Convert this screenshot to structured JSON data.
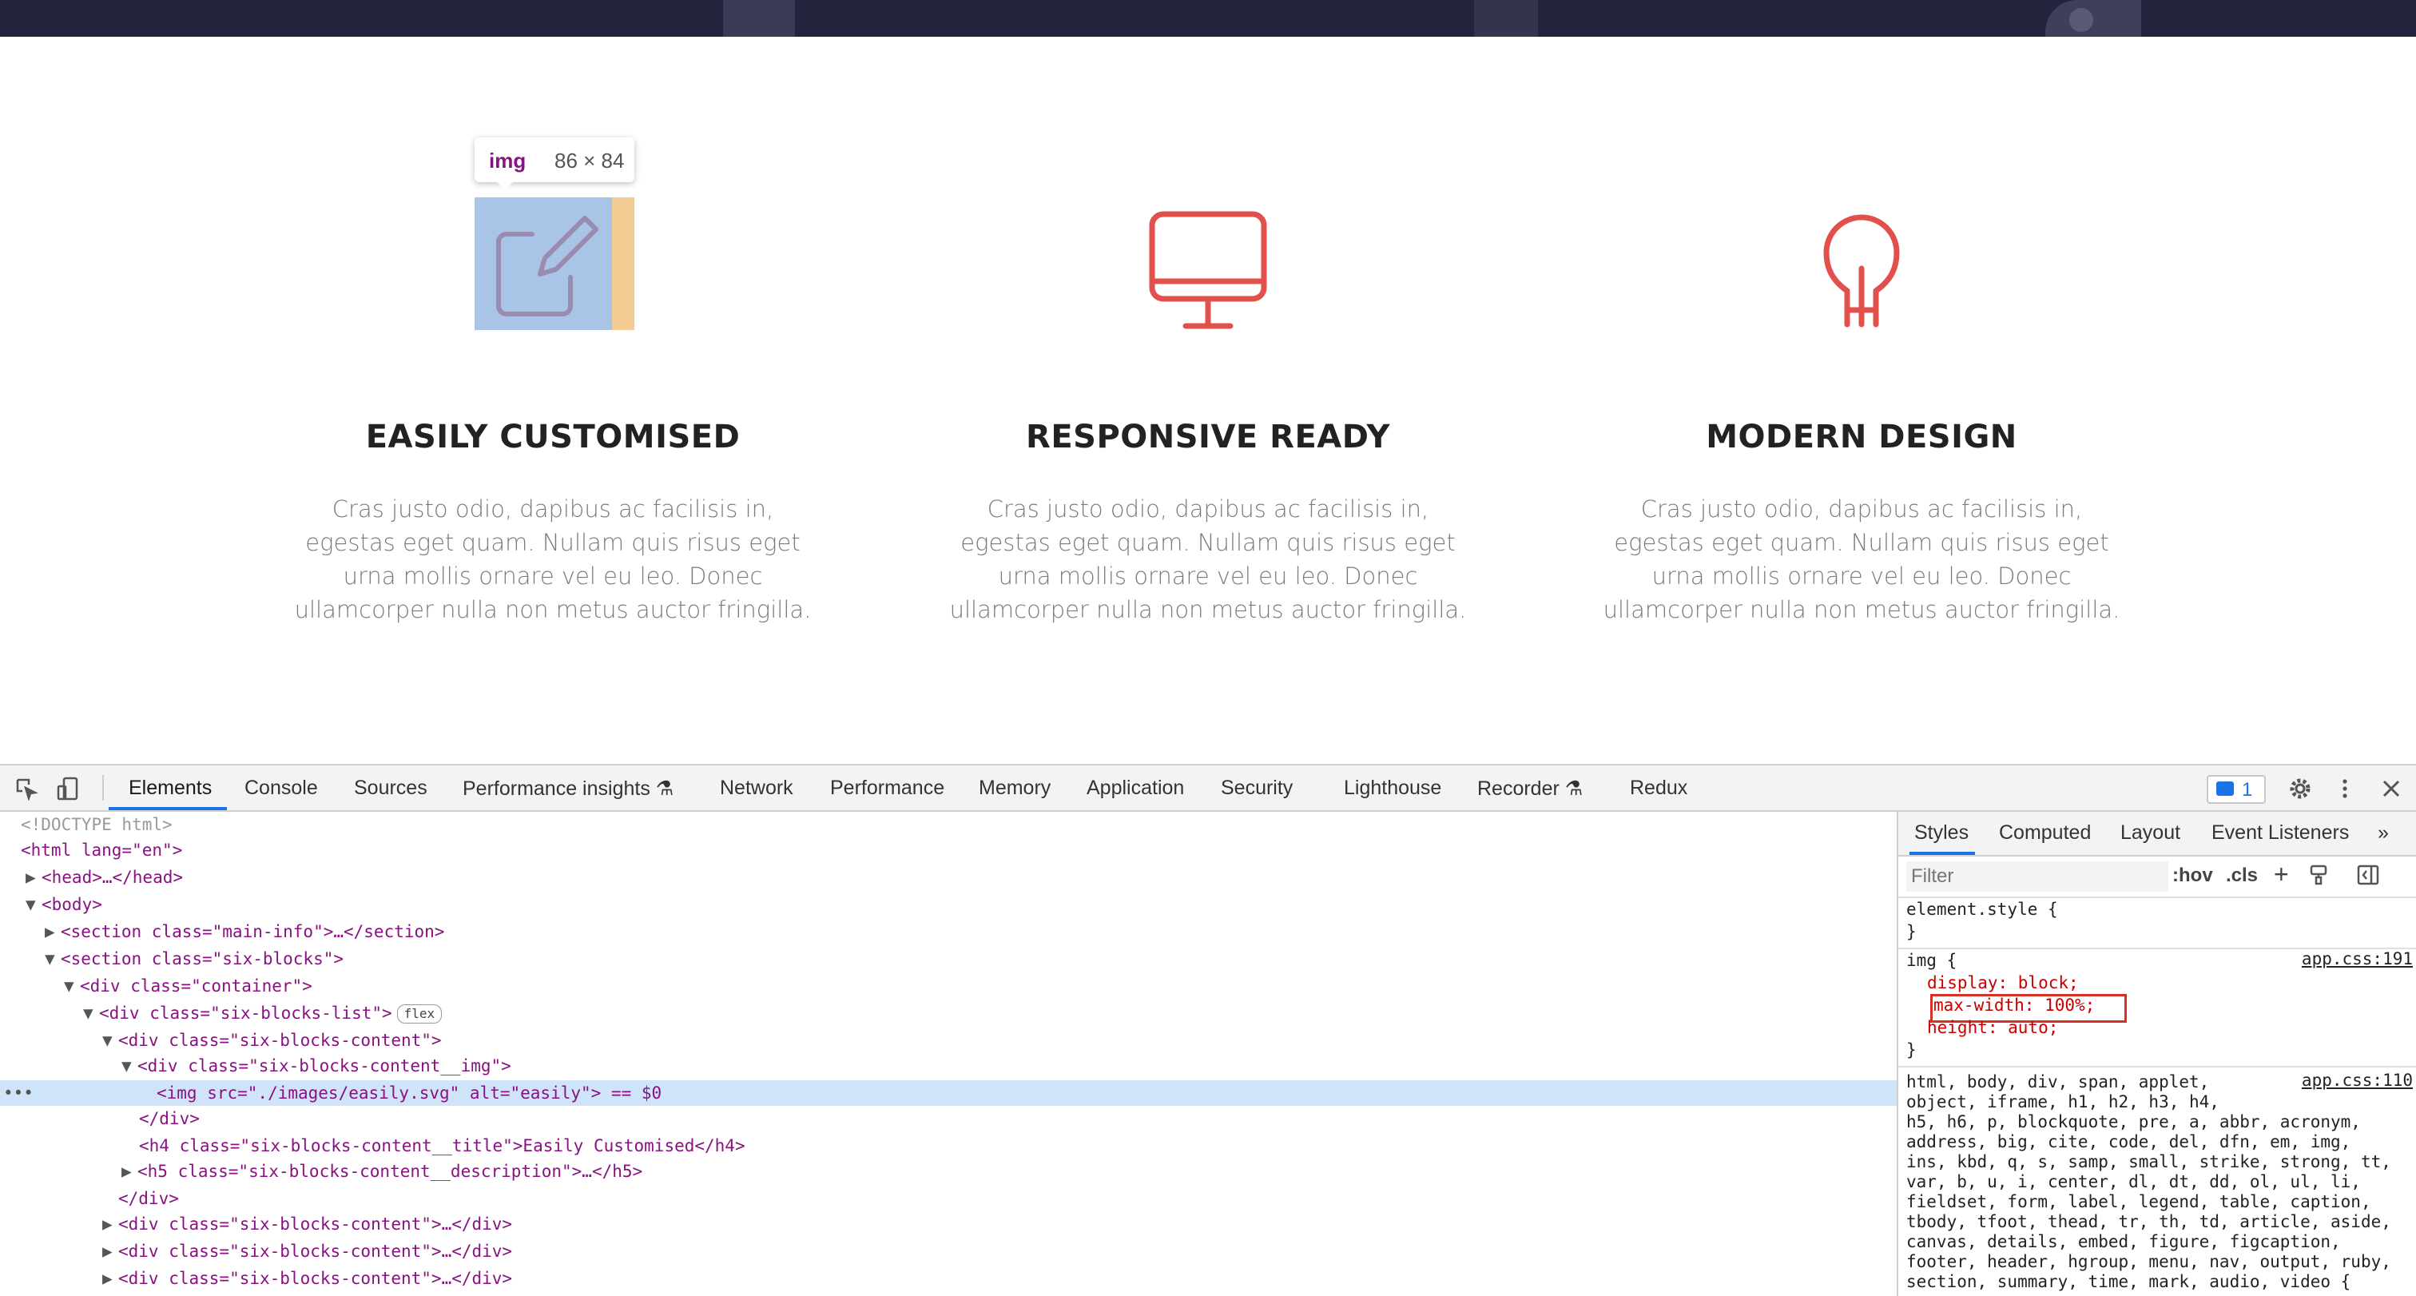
{
  "blocks": [
    {
      "title": "EASILY CUSTOMISED",
      "description": "Cras justo odio, dapibus ac facilisis in, egestas eget quam. Nullam quis risus eget urna mollis ornare vel eu leo. Donec ullamcorper nulla non metus auctor fringilla.",
      "icon": "edit-icon"
    },
    {
      "title": "RESPONSIVE READY",
      "description": "Cras justo odio, dapibus ac facilisis in, egestas eget quam. Nullam quis risus eget urna mollis ornare vel eu leo. Donec ullamcorper nulla non metus auctor fringilla.",
      "icon": "monitor-icon"
    },
    {
      "title": "MODERN DESIGN",
      "description": "Cras justo odio, dapibus ac facilisis in, egestas eget quam. Nullam quis risus eget urna mollis ornare vel eu leo. Donec ullamcorper nulla non metus auctor fringilla.",
      "icon": "lightbulb-icon"
    }
  ],
  "accent_color": "#e2504c",
  "tooltip": {
    "tag": "img",
    "dims": "86 × 84"
  },
  "devtools": {
    "tabs": [
      "Elements",
      "Console",
      "Sources",
      "Performance insights",
      "Network",
      "Performance",
      "Memory",
      "Application",
      "Security",
      "Lighthouse",
      "Recorder",
      "Redux"
    ],
    "active_tab": "Elements",
    "issues_count": "1",
    "dom": [
      "<!DOCTYPE html>",
      "<html lang=\"en\">",
      "<head>…</head>",
      "<body>",
      "<section class=\"main-info\">…</section>",
      "<section class=\"six-blocks\">",
      "<div class=\"container\">",
      "<div class=\"six-blocks-list\">",
      "<div class=\"six-blocks-content\">",
      "<div class=\"six-blocks-content__img\">",
      "<img src=\"./images/easily.svg\" alt=\"easily\"> == $0",
      "</div>",
      "<h4 class=\"six-blocks-content__title\">Easily Customised</h4>",
      "<h5 class=\"six-blocks-content__description\">…</h5>",
      "</div>",
      "<div class=\"six-blocks-content\">…</div>",
      "<div class=\"six-blocks-content\">…</div>",
      "<div class=\"six-blocks-content\">…</div>"
    ],
    "flex_badge": "flex",
    "side_tabs": [
      "Styles",
      "Computed",
      "Layout",
      "Event Listeners"
    ],
    "active_side_tab": "Styles",
    "filter_placeholder": "Filter",
    "hov": ":hov",
    "cls": ".cls",
    "styles": {
      "element_style": "element.style {",
      "close_brace": "}",
      "img_selector": "img {",
      "img_source": "app.css:191",
      "decl_display": "display: block;",
      "decl_max_width": "max-width: 100%;",
      "decl_height": "height: auto;",
      "reset_source": "app.css:110",
      "reset_lines": [
        "html, body, div, span, applet,",
        "object, iframe, h1, h2, h3, h4,",
        "h5, h6, p, blockquote, pre, a, abbr, acronym,",
        "address, big, cite, code, del, dfn, em, img,",
        "ins, kbd, q, s, samp, small, strike, strong, tt,",
        "var, b, u, i, center, dl, dt, dd, ol, ul, li,",
        "fieldset, form, label, legend, table, caption,",
        "tbody, tfoot, thead, tr, th, td, article, aside,",
        "canvas, details, embed, figure, figcaption,",
        "footer, header, hgroup, menu, nav, output, ruby,",
        "section, summary, time, mark, audio, video {"
      ]
    }
  }
}
